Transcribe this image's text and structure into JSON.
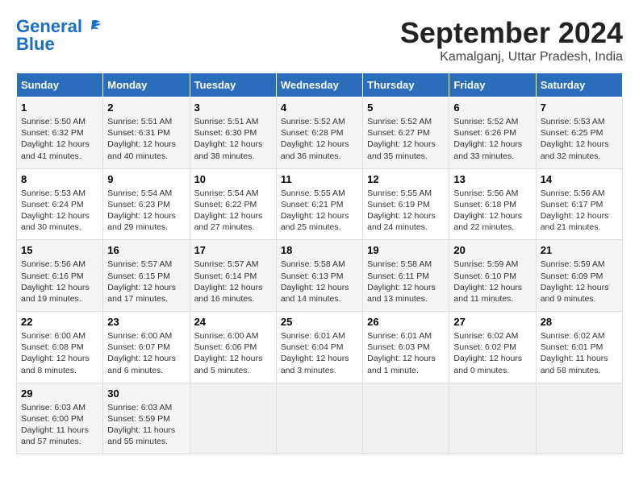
{
  "logo": {
    "part1": "General",
    "part2": "Blue"
  },
  "title": "September 2024",
  "location": "Kamalganj, Uttar Pradesh, India",
  "headers": [
    "Sunday",
    "Monday",
    "Tuesday",
    "Wednesday",
    "Thursday",
    "Friday",
    "Saturday"
  ],
  "weeks": [
    [
      {
        "day": "1",
        "info": "Sunrise: 5:50 AM\nSunset: 6:32 PM\nDaylight: 12 hours\nand 41 minutes."
      },
      {
        "day": "2",
        "info": "Sunrise: 5:51 AM\nSunset: 6:31 PM\nDaylight: 12 hours\nand 40 minutes."
      },
      {
        "day": "3",
        "info": "Sunrise: 5:51 AM\nSunset: 6:30 PM\nDaylight: 12 hours\nand 38 minutes."
      },
      {
        "day": "4",
        "info": "Sunrise: 5:52 AM\nSunset: 6:28 PM\nDaylight: 12 hours\nand 36 minutes."
      },
      {
        "day": "5",
        "info": "Sunrise: 5:52 AM\nSunset: 6:27 PM\nDaylight: 12 hours\nand 35 minutes."
      },
      {
        "day": "6",
        "info": "Sunrise: 5:52 AM\nSunset: 6:26 PM\nDaylight: 12 hours\nand 33 minutes."
      },
      {
        "day": "7",
        "info": "Sunrise: 5:53 AM\nSunset: 6:25 PM\nDaylight: 12 hours\nand 32 minutes."
      }
    ],
    [
      {
        "day": "8",
        "info": "Sunrise: 5:53 AM\nSunset: 6:24 PM\nDaylight: 12 hours\nand 30 minutes."
      },
      {
        "day": "9",
        "info": "Sunrise: 5:54 AM\nSunset: 6:23 PM\nDaylight: 12 hours\nand 29 minutes."
      },
      {
        "day": "10",
        "info": "Sunrise: 5:54 AM\nSunset: 6:22 PM\nDaylight: 12 hours\nand 27 minutes."
      },
      {
        "day": "11",
        "info": "Sunrise: 5:55 AM\nSunset: 6:21 PM\nDaylight: 12 hours\nand 25 minutes."
      },
      {
        "day": "12",
        "info": "Sunrise: 5:55 AM\nSunset: 6:19 PM\nDaylight: 12 hours\nand 24 minutes."
      },
      {
        "day": "13",
        "info": "Sunrise: 5:56 AM\nSunset: 6:18 PM\nDaylight: 12 hours\nand 22 minutes."
      },
      {
        "day": "14",
        "info": "Sunrise: 5:56 AM\nSunset: 6:17 PM\nDaylight: 12 hours\nand 21 minutes."
      }
    ],
    [
      {
        "day": "15",
        "info": "Sunrise: 5:56 AM\nSunset: 6:16 PM\nDaylight: 12 hours\nand 19 minutes."
      },
      {
        "day": "16",
        "info": "Sunrise: 5:57 AM\nSunset: 6:15 PM\nDaylight: 12 hours\nand 17 minutes."
      },
      {
        "day": "17",
        "info": "Sunrise: 5:57 AM\nSunset: 6:14 PM\nDaylight: 12 hours\nand 16 minutes."
      },
      {
        "day": "18",
        "info": "Sunrise: 5:58 AM\nSunset: 6:13 PM\nDaylight: 12 hours\nand 14 minutes."
      },
      {
        "day": "19",
        "info": "Sunrise: 5:58 AM\nSunset: 6:11 PM\nDaylight: 12 hours\nand 13 minutes."
      },
      {
        "day": "20",
        "info": "Sunrise: 5:59 AM\nSunset: 6:10 PM\nDaylight: 12 hours\nand 11 minutes."
      },
      {
        "day": "21",
        "info": "Sunrise: 5:59 AM\nSunset: 6:09 PM\nDaylight: 12 hours\nand 9 minutes."
      }
    ],
    [
      {
        "day": "22",
        "info": "Sunrise: 6:00 AM\nSunset: 6:08 PM\nDaylight: 12 hours\nand 8 minutes."
      },
      {
        "day": "23",
        "info": "Sunrise: 6:00 AM\nSunset: 6:07 PM\nDaylight: 12 hours\nand 6 minutes."
      },
      {
        "day": "24",
        "info": "Sunrise: 6:00 AM\nSunset: 6:06 PM\nDaylight: 12 hours\nand 5 minutes."
      },
      {
        "day": "25",
        "info": "Sunrise: 6:01 AM\nSunset: 6:04 PM\nDaylight: 12 hours\nand 3 minutes."
      },
      {
        "day": "26",
        "info": "Sunrise: 6:01 AM\nSunset: 6:03 PM\nDaylight: 12 hours\nand 1 minute."
      },
      {
        "day": "27",
        "info": "Sunrise: 6:02 AM\nSunset: 6:02 PM\nDaylight: 12 hours\nand 0 minutes."
      },
      {
        "day": "28",
        "info": "Sunrise: 6:02 AM\nSunset: 6:01 PM\nDaylight: 11 hours\nand 58 minutes."
      }
    ],
    [
      {
        "day": "29",
        "info": "Sunrise: 6:03 AM\nSunset: 6:00 PM\nDaylight: 11 hours\nand 57 minutes."
      },
      {
        "day": "30",
        "info": "Sunrise: 6:03 AM\nSunset: 5:59 PM\nDaylight: 11 hours\nand 55 minutes."
      },
      {
        "day": "",
        "info": ""
      },
      {
        "day": "",
        "info": ""
      },
      {
        "day": "",
        "info": ""
      },
      {
        "day": "",
        "info": ""
      },
      {
        "day": "",
        "info": ""
      }
    ]
  ]
}
